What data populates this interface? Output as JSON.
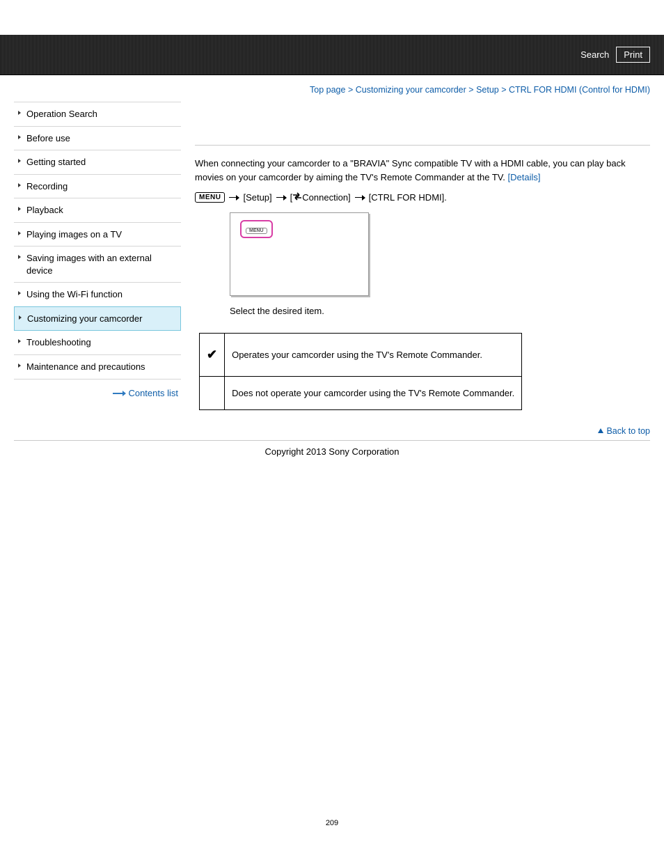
{
  "topbar": {
    "search": "Search",
    "print": "Print"
  },
  "breadcrumb": {
    "top": "Top page",
    "sep": " > ",
    "l1": "Customizing your camcorder",
    "l2": "Setup",
    "l3": "CTRL FOR HDMI (Control for HDMI)"
  },
  "sidebar": {
    "items": [
      {
        "label": "Operation Search"
      },
      {
        "label": "Before use"
      },
      {
        "label": "Getting started"
      },
      {
        "label": "Recording"
      },
      {
        "label": "Playback"
      },
      {
        "label": "Playing images on a TV"
      },
      {
        "label": "Saving images with an external device"
      },
      {
        "label": "Using the Wi-Fi function"
      },
      {
        "label": "Customizing your camcorder",
        "active": true
      },
      {
        "label": "Troubleshooting"
      },
      {
        "label": "Maintenance and precautions"
      }
    ],
    "contents_list": "Contents list"
  },
  "main": {
    "intro": "When connecting your camcorder to a \"BRAVIA\" Sync compatible TV with a HDMI cable, you can play back movies on your camcorder by aiming the TV's Remote Commander at the TV. ",
    "details": "[Details]",
    "menu_chip": "MENU",
    "path_setup": "[Setup]",
    "path_conn": "Connection]",
    "path_conn_prefix": "[",
    "path_ctrl": "[CTRL FOR HDMI].",
    "mock_chip": "MENU",
    "instruction": "Select the desired item.",
    "options": [
      {
        "check": "✔",
        "text": "Operates your camcorder using the TV's Remote Commander."
      },
      {
        "check": "",
        "text": "Does not operate your camcorder using the TV's Remote Commander."
      }
    ]
  },
  "back_to_top": "Back to top",
  "copyright": "Copyright 2013 Sony Corporation",
  "page_number": "209"
}
